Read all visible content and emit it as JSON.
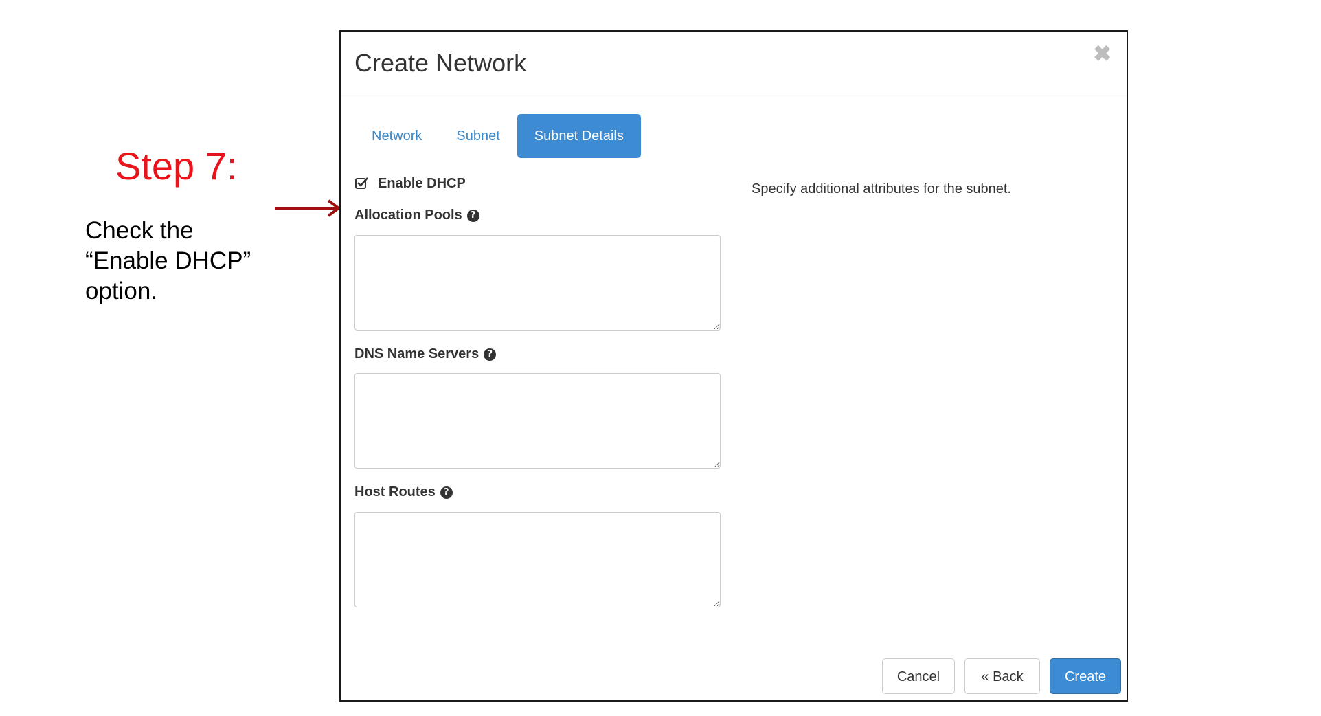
{
  "annotation": {
    "step_title": "Step 7:",
    "instruction_lines": [
      "Check the",
      "“Enable DHCP”",
      "option."
    ],
    "arrow_color": "#a01010",
    "title_color": "#e8131b"
  },
  "modal": {
    "title": "Create Network",
    "close_icon": "close-icon",
    "tabs": [
      {
        "label": "Network",
        "active": false
      },
      {
        "label": "Subnet",
        "active": false
      },
      {
        "label": "Subnet Details",
        "active": true
      }
    ],
    "enable_dhcp": {
      "label": "Enable DHCP",
      "checked": true
    },
    "fields": [
      {
        "label": "Allocation Pools",
        "value": ""
      },
      {
        "label": "DNS Name Servers",
        "value": ""
      },
      {
        "label": "Host Routes",
        "value": ""
      }
    ],
    "description": "Specify additional attributes for the subnet.",
    "buttons": {
      "cancel": "Cancel",
      "back": "« Back",
      "create": "Create"
    },
    "accent_color": "#3d8bd2"
  }
}
